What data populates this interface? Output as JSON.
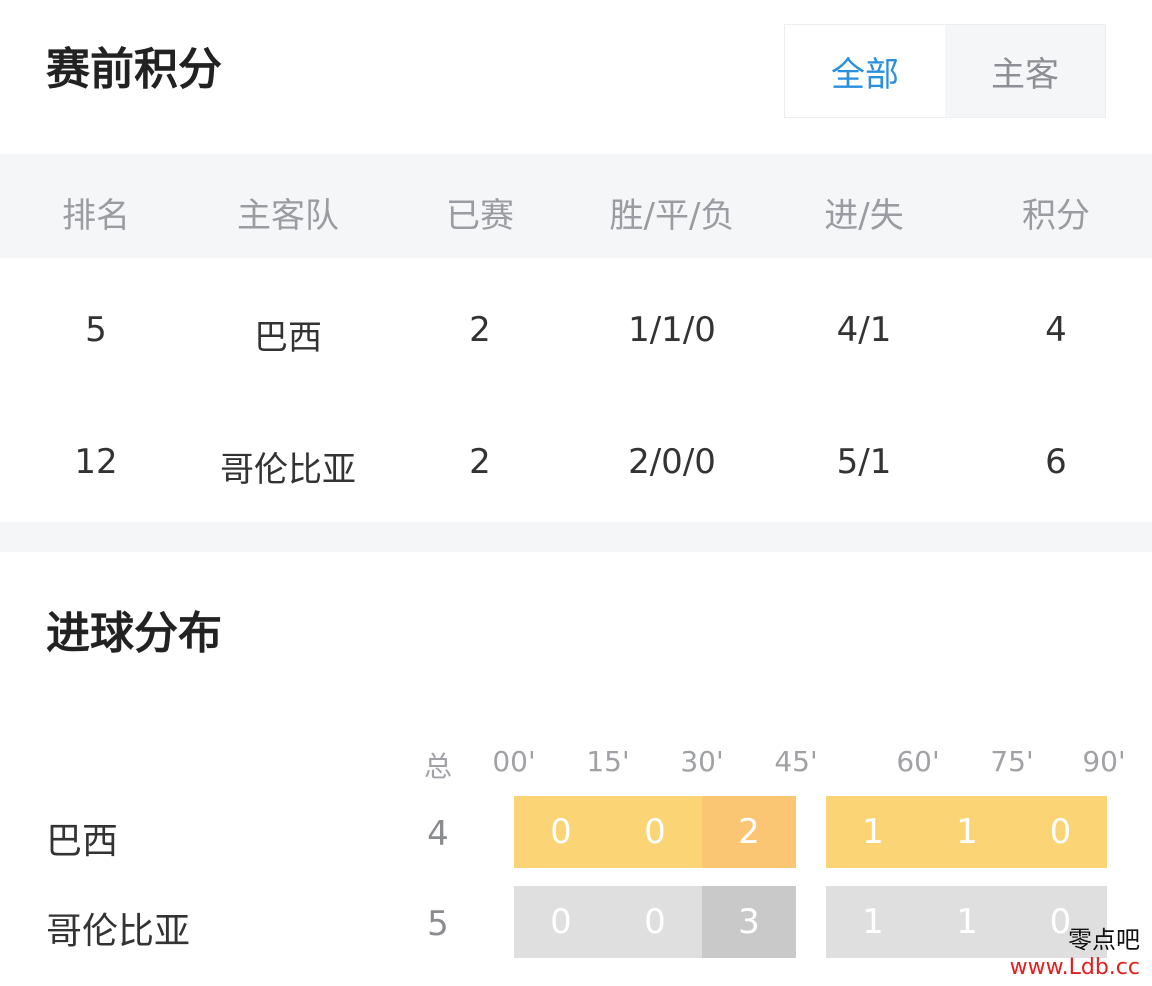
{
  "standings": {
    "title": "赛前积分",
    "tabs": [
      {
        "label": "全部",
        "active": true
      },
      {
        "label": "主客",
        "active": false
      }
    ],
    "columns": [
      "排名",
      "主客队",
      "已赛",
      "胜/平/负",
      "进/失",
      "积分"
    ],
    "rows": [
      [
        "5",
        "巴西",
        "2",
        "1/1/0",
        "4/1",
        "4"
      ],
      [
        "12",
        "哥伦比亚",
        "2",
        "2/0/0",
        "5/1",
        "6"
      ]
    ]
  },
  "goals": {
    "title": "进球分布",
    "total_label": "总",
    "time_labels": [
      "00'",
      "15'",
      "30'",
      "45'",
      "60'",
      "75'",
      "90'"
    ],
    "teams": [
      {
        "name": "巴西",
        "total": "4",
        "first_half": [
          "0",
          "0",
          "2"
        ],
        "second_half": [
          "1",
          "1",
          "0"
        ],
        "color": "#fad475",
        "highlight": "#fbc673"
      },
      {
        "name": "哥伦比亚",
        "total": "5",
        "first_half": [
          "0",
          "0",
          "3"
        ],
        "second_half": [
          "1",
          "1",
          "0"
        ],
        "color": "#dfdfdf",
        "highlight": "#c9c9c9"
      }
    ]
  },
  "watermark": {
    "line1": "零点吧",
    "line2": "www.Ldb.cc"
  },
  "colors": {
    "accent": "#2b8fdb",
    "header_bg": "#f5f6f8"
  }
}
